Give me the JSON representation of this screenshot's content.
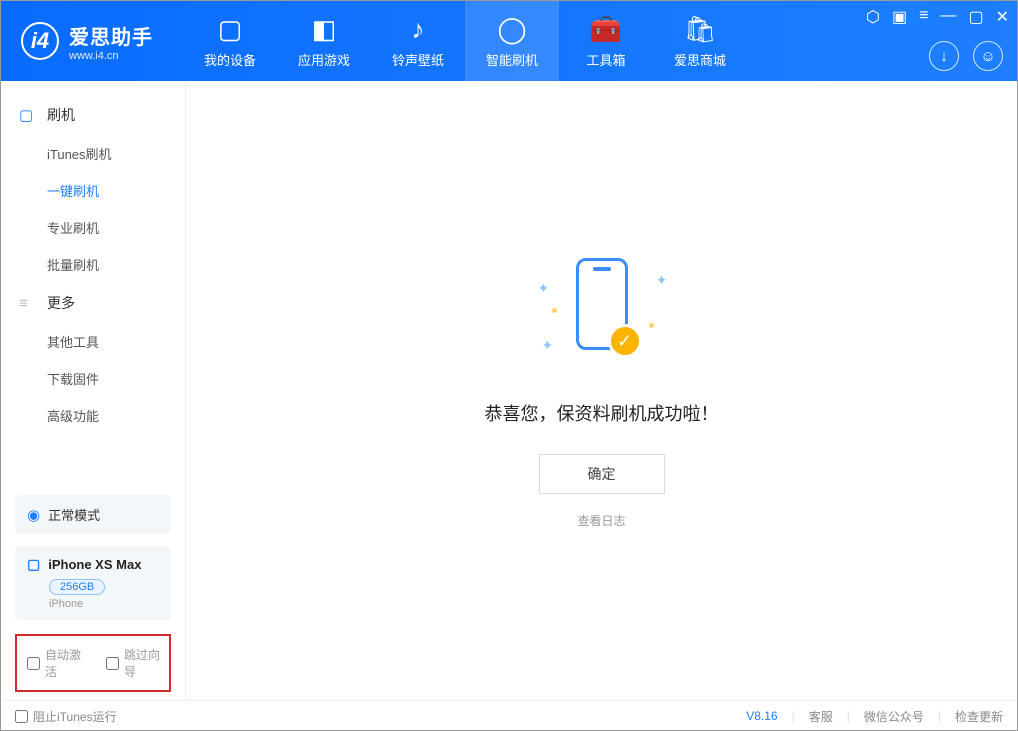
{
  "app": {
    "title": "爱思助手",
    "subtitle": "www.i4.cn"
  },
  "nav": {
    "tabs": [
      {
        "label": "我的设备",
        "icon": "phone"
      },
      {
        "label": "应用游戏",
        "icon": "cube"
      },
      {
        "label": "铃声壁纸",
        "icon": "music"
      },
      {
        "label": "智能刷机",
        "icon": "sync"
      },
      {
        "label": "工具箱",
        "icon": "toolbox"
      },
      {
        "label": "爱思商城",
        "icon": "bag"
      }
    ],
    "active_index": 3
  },
  "sidebar": {
    "section1": {
      "title": "刷机",
      "items": [
        "iTunes刷机",
        "一键刷机",
        "专业刷机",
        "批量刷机"
      ],
      "active_index": 1
    },
    "section2": {
      "title": "更多",
      "items": [
        "其他工具",
        "下载固件",
        "高级功能"
      ]
    },
    "mode": "正常模式",
    "device": {
      "name": "iPhone XS Max",
      "storage": "256GB",
      "type": "iPhone"
    },
    "checks": {
      "auto_activate": "自动激活",
      "skip_guide": "跳过向导"
    }
  },
  "main": {
    "success_msg": "恭喜您，保资料刷机成功啦！",
    "ok_btn": "确定",
    "view_log": "查看日志"
  },
  "footer": {
    "block_itunes": "阻止iTunes运行",
    "version": "V8.16",
    "links": [
      "客服",
      "微信公众号",
      "检查更新"
    ]
  }
}
